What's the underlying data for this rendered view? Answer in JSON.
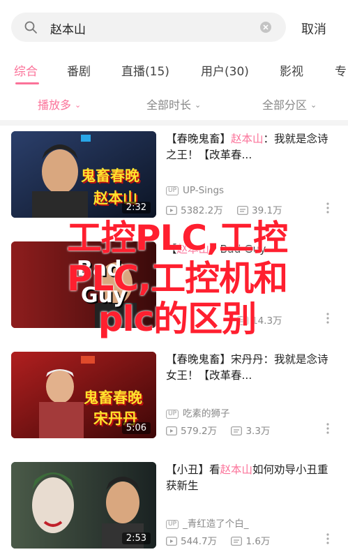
{
  "search": {
    "query": "赵本山",
    "cancel_label": "取消"
  },
  "tabs": [
    {
      "label": "综合",
      "active": true
    },
    {
      "label": "番剧"
    },
    {
      "label": "直播(15)"
    },
    {
      "label": "用户(30)"
    },
    {
      "label": "影视"
    },
    {
      "label": "专"
    }
  ],
  "filters": [
    {
      "label": "播放多",
      "active": true
    },
    {
      "label": "全部时长"
    },
    {
      "label": "全部分区"
    }
  ],
  "videos": [
    {
      "title_parts": [
        "【春晚鬼畜】",
        "赵本山",
        "：我就是念诗之王！【改革春..."
      ],
      "thumb_caption_top": "鬼畜春晚",
      "thumb_caption_bottom": "赵本山",
      "duration": "2:32",
      "uploader": "UP-Sings",
      "views": "5382.2万",
      "danmaku": "39.1万"
    },
    {
      "title_parts": [
        "【",
        "赵本山",
        "】Bad Guy"
      ],
      "thumb_caption_top": "Bad",
      "thumb_caption_bottom": "Guy",
      "duration": "",
      "uploader": "",
      "views": "",
      "danmaku": "14.3万"
    },
    {
      "title_parts": [
        "【春晚鬼畜】宋丹丹：我就是念诗女王！【改革春..."
      ],
      "thumb_caption_top": "鬼畜春晚",
      "thumb_caption_bottom": "宋丹丹",
      "duration": "5:06",
      "uploader": "吃素的狮子",
      "views": "579.2万",
      "danmaku": "3.3万"
    },
    {
      "title_parts": [
        "【小丑】看",
        "赵本山",
        "如何劝导小丑重获新生"
      ],
      "thumb_caption_top": "",
      "thumb_caption_bottom": "",
      "duration": "2:53",
      "uploader": "_青红造了个白_",
      "views": "544.7万",
      "danmaku": "1.6万"
    }
  ],
  "watermark": {
    "line1": "工控PLC,工控",
    "line2": "PLC,工控机和",
    "line3": "plc的区别"
  },
  "colors": {
    "accent": "#fb7299",
    "watermark": "#ff1f2f"
  }
}
